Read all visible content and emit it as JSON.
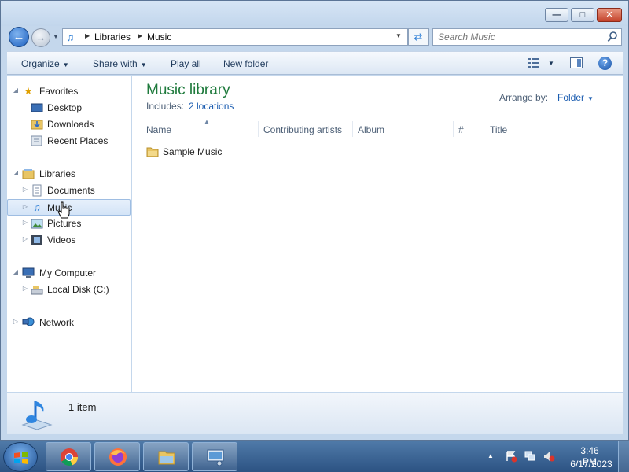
{
  "address": {
    "crumbs": [
      "Libraries",
      "Music"
    ]
  },
  "search": {
    "placeholder": "Search Music"
  },
  "toolbar": {
    "organize": "Organize",
    "share_with": "Share with",
    "play_all": "Play all",
    "new_folder": "New folder",
    "help": "?"
  },
  "nav": {
    "favorites": "Favorites",
    "desktop": "Desktop",
    "downloads": "Downloads",
    "recent_places": "Recent Places",
    "libraries": "Libraries",
    "documents": "Documents",
    "music": "Music",
    "pictures": "Pictures",
    "videos": "Videos",
    "my_computer": "My Computer",
    "local_disk": "Local Disk (C:)",
    "network": "Network"
  },
  "content": {
    "title": "Music library",
    "includes_label": "Includes:",
    "includes_link": "2 locations",
    "arrange_label": "Arrange by:",
    "arrange_value": "Folder",
    "columns": [
      "Name",
      "Contributing artists",
      "Album",
      "#",
      "Title"
    ],
    "items": [
      {
        "name": "Sample Music"
      }
    ]
  },
  "details": {
    "count": "1 item"
  },
  "taskbar": {
    "time": "3:46 PM",
    "date": "6/17/2023"
  },
  "colors": {
    "library_title": "#1e7a3c",
    "link": "#1a5cb0",
    "taskbar": "#2c5383",
    "selection": "#d4e4f7"
  },
  "icons": {
    "back": "back-arrow-icon",
    "forward": "forward-arrow-icon",
    "music": "music-note-icon",
    "folder": "folder-icon",
    "search": "search-icon"
  }
}
